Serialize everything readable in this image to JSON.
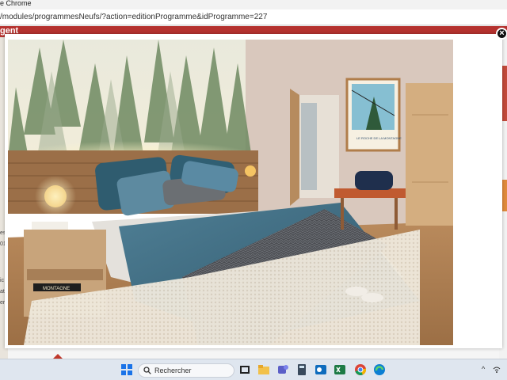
{
  "browser": {
    "title": "e Chrome",
    "url": "/modules/programmesNeufs/?action=editionProgramme&idProgramme=227"
  },
  "page": {
    "header_fragment": "gent",
    "left_fragments": [
      "es",
      "01",
      "ic",
      "at",
      "er"
    ]
  },
  "lightbox": {
    "close_label": "×",
    "image": {
      "subject": "chalet bedroom with forest mural, wooden headboard, blue bedding, knit throw, shaggy rug, ski poster, open bathroom door",
      "poster_text": "LE ROCHE DE LA MONTAGNE",
      "book_text": "MONTAGNE"
    }
  },
  "taskbar": {
    "search_placeholder": "Rechercher",
    "apps": [
      "windows-start",
      "search",
      "task-view",
      "file-explorer",
      "teams",
      "calculator",
      "outlook",
      "excel",
      "chrome",
      "edge"
    ],
    "tray_caret": "^"
  },
  "colors": {
    "header_red": "#b5322f",
    "taskbar_bg": "#dfe6ef"
  }
}
